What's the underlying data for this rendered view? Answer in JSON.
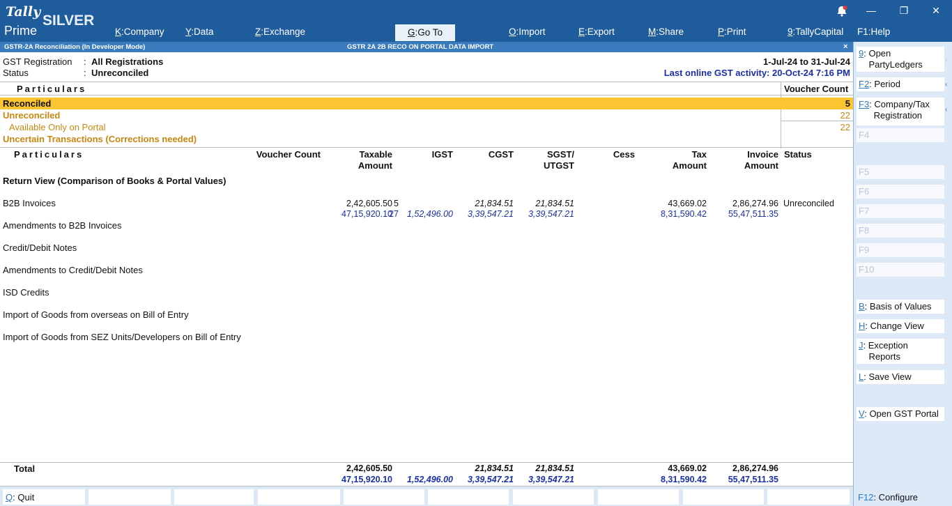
{
  "app": {
    "brand_top": "Tally",
    "brand_bottom": "Prime",
    "edition": "SILVER"
  },
  "topnav": [
    {
      "key": "K",
      "label": "Company"
    },
    {
      "key": "Y",
      "label": "Data"
    },
    {
      "key": "Z",
      "label": "Exchange"
    },
    {
      "key": "G",
      "label": "Go To"
    },
    {
      "key": "O",
      "label": "Import"
    },
    {
      "key": "E",
      "label": "Export"
    },
    {
      "key": "M",
      "label": "Share"
    },
    {
      "key": "P",
      "label": "Print"
    },
    {
      "key": "9",
      "label": "TallyCapital"
    },
    {
      "key": "F1",
      "label": "Help"
    }
  ],
  "subheader": {
    "left": "GSTR-2A Reconciliation (In Developer Mode)",
    "center": "GSTR 2A 2B RECO ON PORTAL DATA IMPORT",
    "close": "×"
  },
  "info": {
    "gst_reg_label": "GST Registration",
    "gst_reg_value": "All Registrations",
    "status_label": "Status",
    "status_value": "Unreconciled",
    "sep": ":",
    "period": "1-Jul-24 to 31-Jul-24",
    "last_online": "Last online GST activity: 20-Oct-24 7:16 PM"
  },
  "summary": {
    "col_particulars": "Particulars",
    "col_voucher_count": "Voucher Count",
    "rows": [
      {
        "label": "Reconciled",
        "value": "5"
      },
      {
        "label": "Unreconciled",
        "value": "22"
      },
      {
        "label": "Available Only on Portal",
        "value": "22"
      },
      {
        "label": "Uncertain Transactions (Corrections needed)",
        "value": ""
      }
    ]
  },
  "main": {
    "headers": {
      "particulars": "Particulars",
      "voucher_count": "Voucher Count",
      "taxable_1": "Taxable",
      "taxable_2": "Amount",
      "igst": "IGST",
      "cgst": "CGST",
      "sgst_1": "SGST/",
      "sgst_2": "UTGST",
      "cess": "Cess",
      "tax_1": "Tax",
      "tax_2": "Amount",
      "invoice_1": "Invoice",
      "invoice_2": "Amount",
      "status": "Status"
    },
    "section_title": "Return View (Comparison of Books & Portal Values)",
    "b2b": {
      "label": "B2B Invoices",
      "books": {
        "vc": "5",
        "taxable": "2,42,605.50",
        "igst": "",
        "cgst": "21,834.51",
        "sgst": "21,834.51",
        "tax": "43,669.02",
        "invoice": "2,86,274.96",
        "status": "Unreconciled"
      },
      "portal": {
        "vc": "27",
        "taxable": "47,15,920.10",
        "igst": "1,52,496.00",
        "cgst": "3,39,547.21",
        "sgst": "3,39,547.21",
        "tax": "8,31,590.42",
        "invoice": "55,47,511.35"
      }
    },
    "other_rows": [
      "Amendments to B2B Invoices",
      "Credit/Debit Notes",
      "Amendments to Credit/Debit Notes",
      "ISD Credits",
      "Import of Goods from overseas on Bill of Entry",
      "Import of Goods from SEZ Units/Developers on Bill of Entry"
    ],
    "total": {
      "label": "Total",
      "books": {
        "taxable": "2,42,605.50",
        "cgst": "21,834.51",
        "sgst": "21,834.51",
        "tax": "43,669.02",
        "invoice": "2,86,274.96"
      },
      "portal": {
        "taxable": "47,15,920.10",
        "igst": "1,52,496.00",
        "cgst": "3,39,547.21",
        "sgst": "3,39,547.21",
        "tax": "8,31,590.42",
        "invoice": "55,47,511.35"
      }
    }
  },
  "right_panel": [
    {
      "key": "9",
      "l1": "Open",
      "l2": "PartyLedgers"
    },
    {
      "key": "F2",
      "l1": "Period"
    },
    {
      "key": "F3",
      "l1": "Company/Tax",
      "l2": "Registration"
    },
    {
      "key": "F4"
    },
    {
      "key": "F5"
    },
    {
      "key": "F6"
    },
    {
      "key": "F7"
    },
    {
      "key": "F8"
    },
    {
      "key": "F9"
    },
    {
      "key": "F10"
    },
    {
      "key": "B",
      "l1": "Basis of Values"
    },
    {
      "key": "H",
      "l1": "Change View"
    },
    {
      "key": "J",
      "l1": "Exception",
      "l2": "Reports"
    },
    {
      "key": "L",
      "l1": "Save View"
    },
    {
      "key": "V",
      "l1": "Open GST Portal"
    },
    {
      "key": "F12",
      "l1": "Configure"
    }
  ],
  "bottom": {
    "quit_key": "Q",
    "quit_label": "Quit"
  },
  "colors": {
    "topbar": "#1f5c9c",
    "highlight": "#fbc531",
    "unreconciled": "#c9860f",
    "portal_blue": "#1a2fa8",
    "panel": "#dde9f6"
  }
}
